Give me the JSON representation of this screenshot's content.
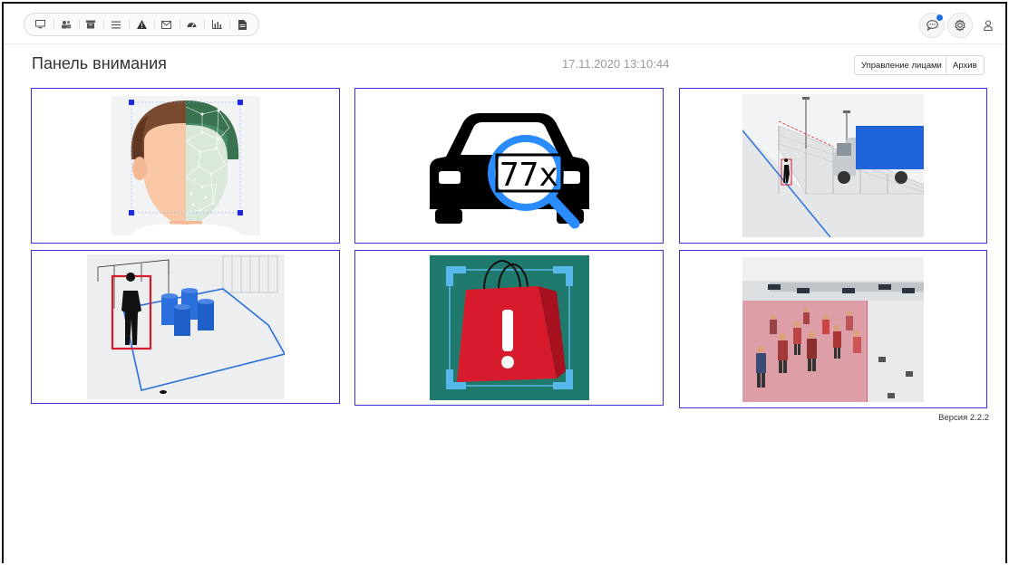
{
  "page": {
    "title": "Панель внимания",
    "timestamp": "17.11.2020 13:10:44",
    "version": "Версия 2.2.2"
  },
  "header_buttons": {
    "faces": "Управление лицами",
    "archive": "Архив"
  },
  "toolbar": {
    "icons": [
      "monitor-icon",
      "users-icon",
      "archive-box-icon",
      "list-icon",
      "warning-icon",
      "mail-icon",
      "dashboard-icon",
      "chart-icon",
      "document-icon"
    ]
  },
  "top_right": {
    "icons": [
      "chat-icon",
      "gear-icon",
      "user-icon"
    ],
    "notification": true
  },
  "tiles": [
    {
      "id": "face-recognition"
    },
    {
      "id": "license-plate-recognition",
      "plate_text": "77x"
    },
    {
      "id": "perimeter-intrusion"
    },
    {
      "id": "zone-intrusion"
    },
    {
      "id": "abandoned-object"
    },
    {
      "id": "crowd-detection"
    }
  ],
  "colors": {
    "tile_border": "#3a2fd8",
    "accent_blue": "#1e6fe6",
    "alert_red": "#d81b2c"
  }
}
